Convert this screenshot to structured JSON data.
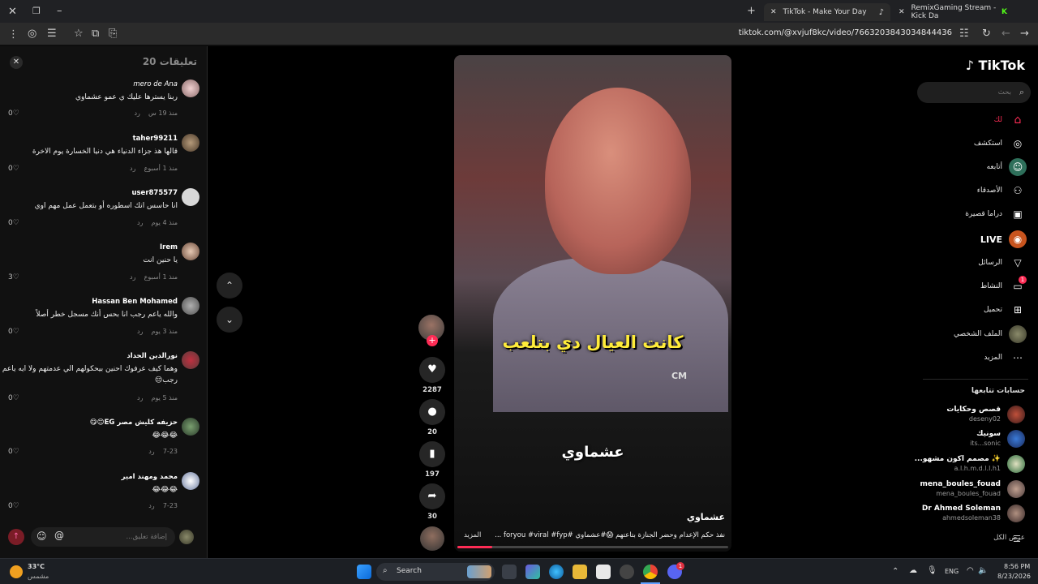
{
  "browser": {
    "tabs": [
      {
        "title": "TikTok - Make Your Day",
        "active": true
      },
      {
        "title": "RemixGaming Stream - Kick Da",
        "active": false
      }
    ],
    "url": "tiktok.com/@xvjuf8kc/video/7663203843034844436"
  },
  "comments_panel": {
    "title": "تعليقات",
    "count": "20",
    "input_placeholder": "إضافة تعليق...",
    "items": [
      {
        "name": "mero de Ana",
        "text": "ربنا يسترها عليك ي عمو عشماوي",
        "time": "منذ 19 س",
        "reply": "رد",
        "likes": "0"
      },
      {
        "name": "taher99211",
        "text": "قالها هذ جزاء الدنياء هي دنيا الخسارة يوم الاخرة",
        "time": "منذ 1 أسبوع",
        "reply": "رد",
        "likes": "0"
      },
      {
        "name": "user875577",
        "text": "انا حاسس انك اسطوره أو بتعمل عمل مهم اوي",
        "time": "منذ 4 يوم",
        "reply": "رد",
        "likes": "0"
      },
      {
        "name": "Irem",
        "text": "يا حنين انت",
        "time": "منذ 1 أسبوع",
        "reply": "رد",
        "likes": "3"
      },
      {
        "name": "Hassan Ben Mohamed",
        "text": "والله ياعم رجب انا بحس أنك مسجل خطر أصلاً",
        "time": "منذ 3 يوم",
        "reply": "رد",
        "likes": "0"
      },
      {
        "name": "نورالدين الحداد",
        "text": "وهما كيف عرفوك احنين بيحكولهم الي عدمتهم ولا ايه ياعم رجب😔",
        "time": "منذ 5 يوم",
        "reply": "رد",
        "likes": "0"
      },
      {
        "name": "حزيفه كليش مصر EG😊😋",
        "text": "😂😂😂",
        "time": "7-23",
        "reply": "رد",
        "likes": "0"
      },
      {
        "name": "محمد ومهند امير",
        "text": "😂😂😂",
        "time": "7-23",
        "reply": "رد",
        "likes": "0"
      }
    ]
  },
  "video": {
    "overlay_text": "كانت العيال دي بتلعب",
    "watermark": "CM",
    "caption_overlay": "عشماوي",
    "author": "عشماوي",
    "description": "نفذ حكم الإعدام وحضر الجنازة بتاعتهم 😱#عشماوي #foryou #viral #fyp ...",
    "more": "المزيد",
    "progress": 0.13
  },
  "actions": {
    "likes": "2287",
    "comments": "20",
    "saves": "197",
    "shares": "30"
  },
  "sidebar": {
    "logo": "TikTok",
    "search_placeholder": "بحث",
    "nav": [
      {
        "label": "لك",
        "icon": "home-icon"
      },
      {
        "label": "استكشف",
        "icon": "compass-icon"
      },
      {
        "label": "أتابعه",
        "icon": "following-icon"
      },
      {
        "label": "الأصدقاء",
        "icon": "friends-icon"
      },
      {
        "label": "دراما قصيرة",
        "icon": "drama-icon"
      },
      {
        "label": "LIVE",
        "icon": "live-icon"
      },
      {
        "label": "الرسائل",
        "icon": "messages-icon"
      },
      {
        "label": "النشاط",
        "icon": "activity-icon",
        "badge": "1"
      },
      {
        "label": "تحميل",
        "icon": "upload-icon"
      },
      {
        "label": "الملف الشخصي",
        "icon": "profile-icon"
      },
      {
        "label": "المزيد",
        "icon": "more-icon"
      }
    ],
    "following_title": "حسابات تتابعها",
    "following": [
      {
        "name": "قصص وحكايات",
        "handle": "deseny02"
      },
      {
        "name": "سونيك",
        "handle": "its...sonic"
      },
      {
        "name": "✨ مصمم اكون مشهو...",
        "handle": "a.l.h.m.d.l.l.h1"
      },
      {
        "name": "mena_boules_fouad",
        "handle": "mena_boules_fouad"
      },
      {
        "name": "Dr Ahmed Soleman",
        "handle": "ahmedsoleman38"
      }
    ],
    "see_all": "عرض الكل"
  },
  "taskbar": {
    "weather_temp": "33°C",
    "weather_desc": "مشمس",
    "search_label": "Search",
    "lang": "ENG",
    "time": "8:56 PM",
    "date": "8/23/2026",
    "discord_badge": "1"
  },
  "colors": {
    "accent": "#fe2c55",
    "overlay_yellow": "#ffec3a"
  }
}
